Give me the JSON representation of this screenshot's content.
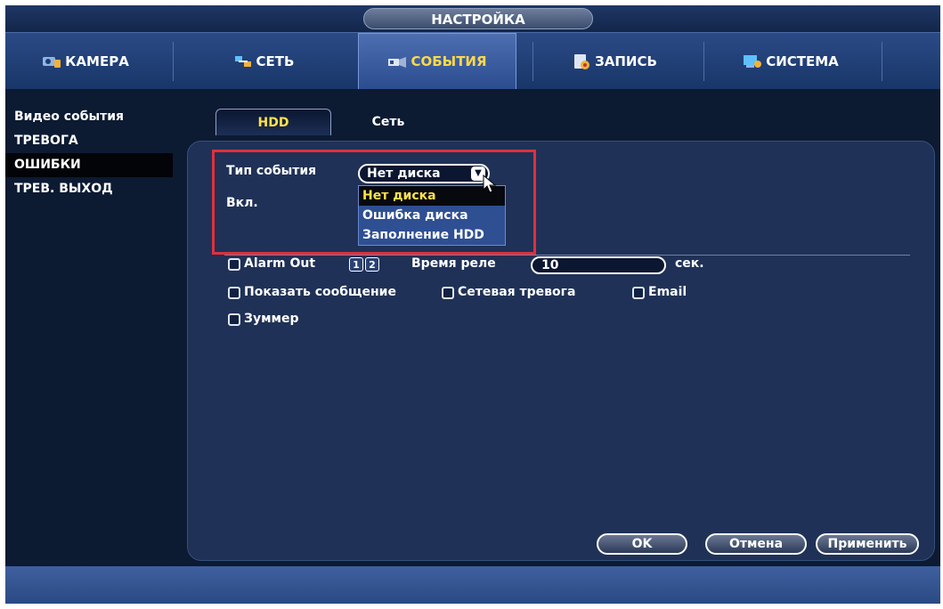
{
  "window": {
    "title": "НАСТРОЙКА"
  },
  "tabs": [
    {
      "label": "КАМЕРА",
      "icon": "camera-icon"
    },
    {
      "label": "СЕТЬ",
      "icon": "network-icon"
    },
    {
      "label": "СОБЫТИЯ",
      "icon": "events-icon",
      "active": true
    },
    {
      "label": "ЗАПИСЬ",
      "icon": "record-icon"
    },
    {
      "label": "СИСТЕМА",
      "icon": "system-icon"
    }
  ],
  "sidebar": {
    "items": [
      {
        "label": "Видео события"
      },
      {
        "label": "ТРЕВОГА"
      },
      {
        "label": "ОШИБКИ",
        "active": true
      },
      {
        "label": "ТРЕВ. ВЫХОД"
      }
    ]
  },
  "subtabs": [
    {
      "label": "HDD",
      "active": true
    },
    {
      "label": "Сеть"
    }
  ],
  "form": {
    "event_type_label": "Тип события",
    "event_type_value": "Нет диска",
    "enable_label": "Вкл.",
    "dropdown_options": [
      "Нет диска",
      "Ошибка диска",
      "Заполнение HDD"
    ],
    "alarm_out_label": "Alarm Out",
    "alarm_out_channels": [
      "1",
      "2"
    ],
    "relay_time_label": "Время реле",
    "relay_time_value": "10",
    "relay_time_unit": "сек.",
    "show_message_label": "Показать сообщение",
    "network_alarm_label": "Сетевая тревога",
    "email_label": "Email",
    "buzzer_label": "Зуммер"
  },
  "buttons": {
    "ok": "OK",
    "cancel": "Отмена",
    "apply": "Применить"
  },
  "colors": {
    "accent_yellow": "#ffe24a",
    "highlight_red": "#e0303c",
    "panel": "#1f3156"
  }
}
